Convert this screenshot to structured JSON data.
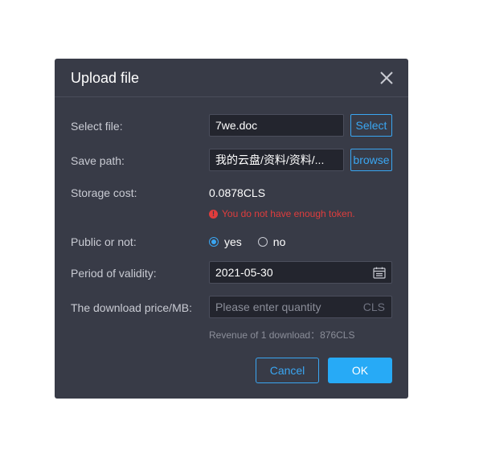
{
  "dialog": {
    "title": "Upload file",
    "close_icon": "close-icon",
    "select_file": {
      "label": "Select file:",
      "value": "7we.doc",
      "button": "Select"
    },
    "save_path": {
      "label": "Save path:",
      "value": "我的云盘/资料/资料/...",
      "button": "browse"
    },
    "storage_cost": {
      "label": "Storage cost:",
      "value": "0.0878CLS",
      "error": "You do not have enough token.",
      "error_icon": "exclamation-icon"
    },
    "public": {
      "label": "Public or not:",
      "options": [
        {
          "label": "yes",
          "checked": true
        },
        {
          "label": "no",
          "checked": false
        }
      ]
    },
    "validity": {
      "label": "Period of validity:",
      "value": "2021-05-30",
      "icon": "calendar-icon"
    },
    "price": {
      "label": "The download price/MB:",
      "placeholder": "Please enter quantity",
      "unit": "CLS"
    },
    "revenue_hint": "Revenue of 1 download：876CLS",
    "cancel_label": "Cancel",
    "ok_label": "OK"
  },
  "colors": {
    "dialog_bg": "#383b47",
    "accent": "#3aa6f2",
    "primary_button": "#27aaf6",
    "error": "#e03d3d"
  }
}
